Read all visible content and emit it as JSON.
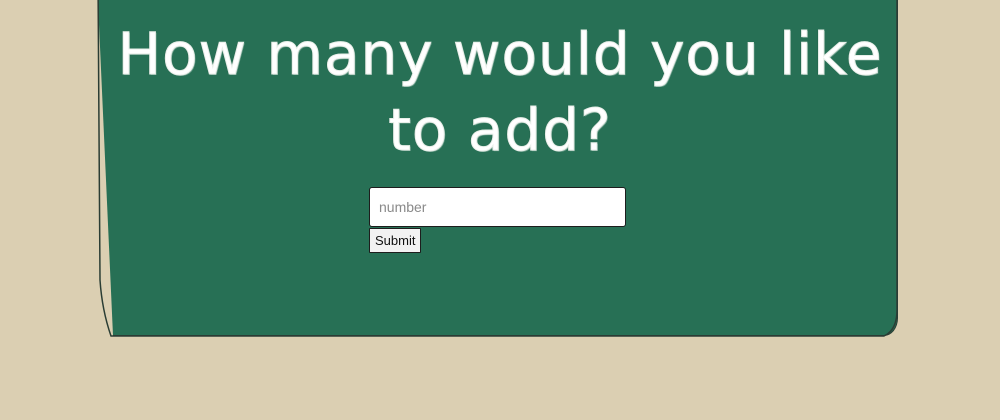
{
  "main": {
    "question": "How many would you like to add?",
    "form": {
      "input_placeholder": "number",
      "input_value": "",
      "submit_label": "Submit"
    }
  },
  "colors": {
    "page_background": "#dbcfb2",
    "board_background": "#277055",
    "text": "#ffffff"
  }
}
